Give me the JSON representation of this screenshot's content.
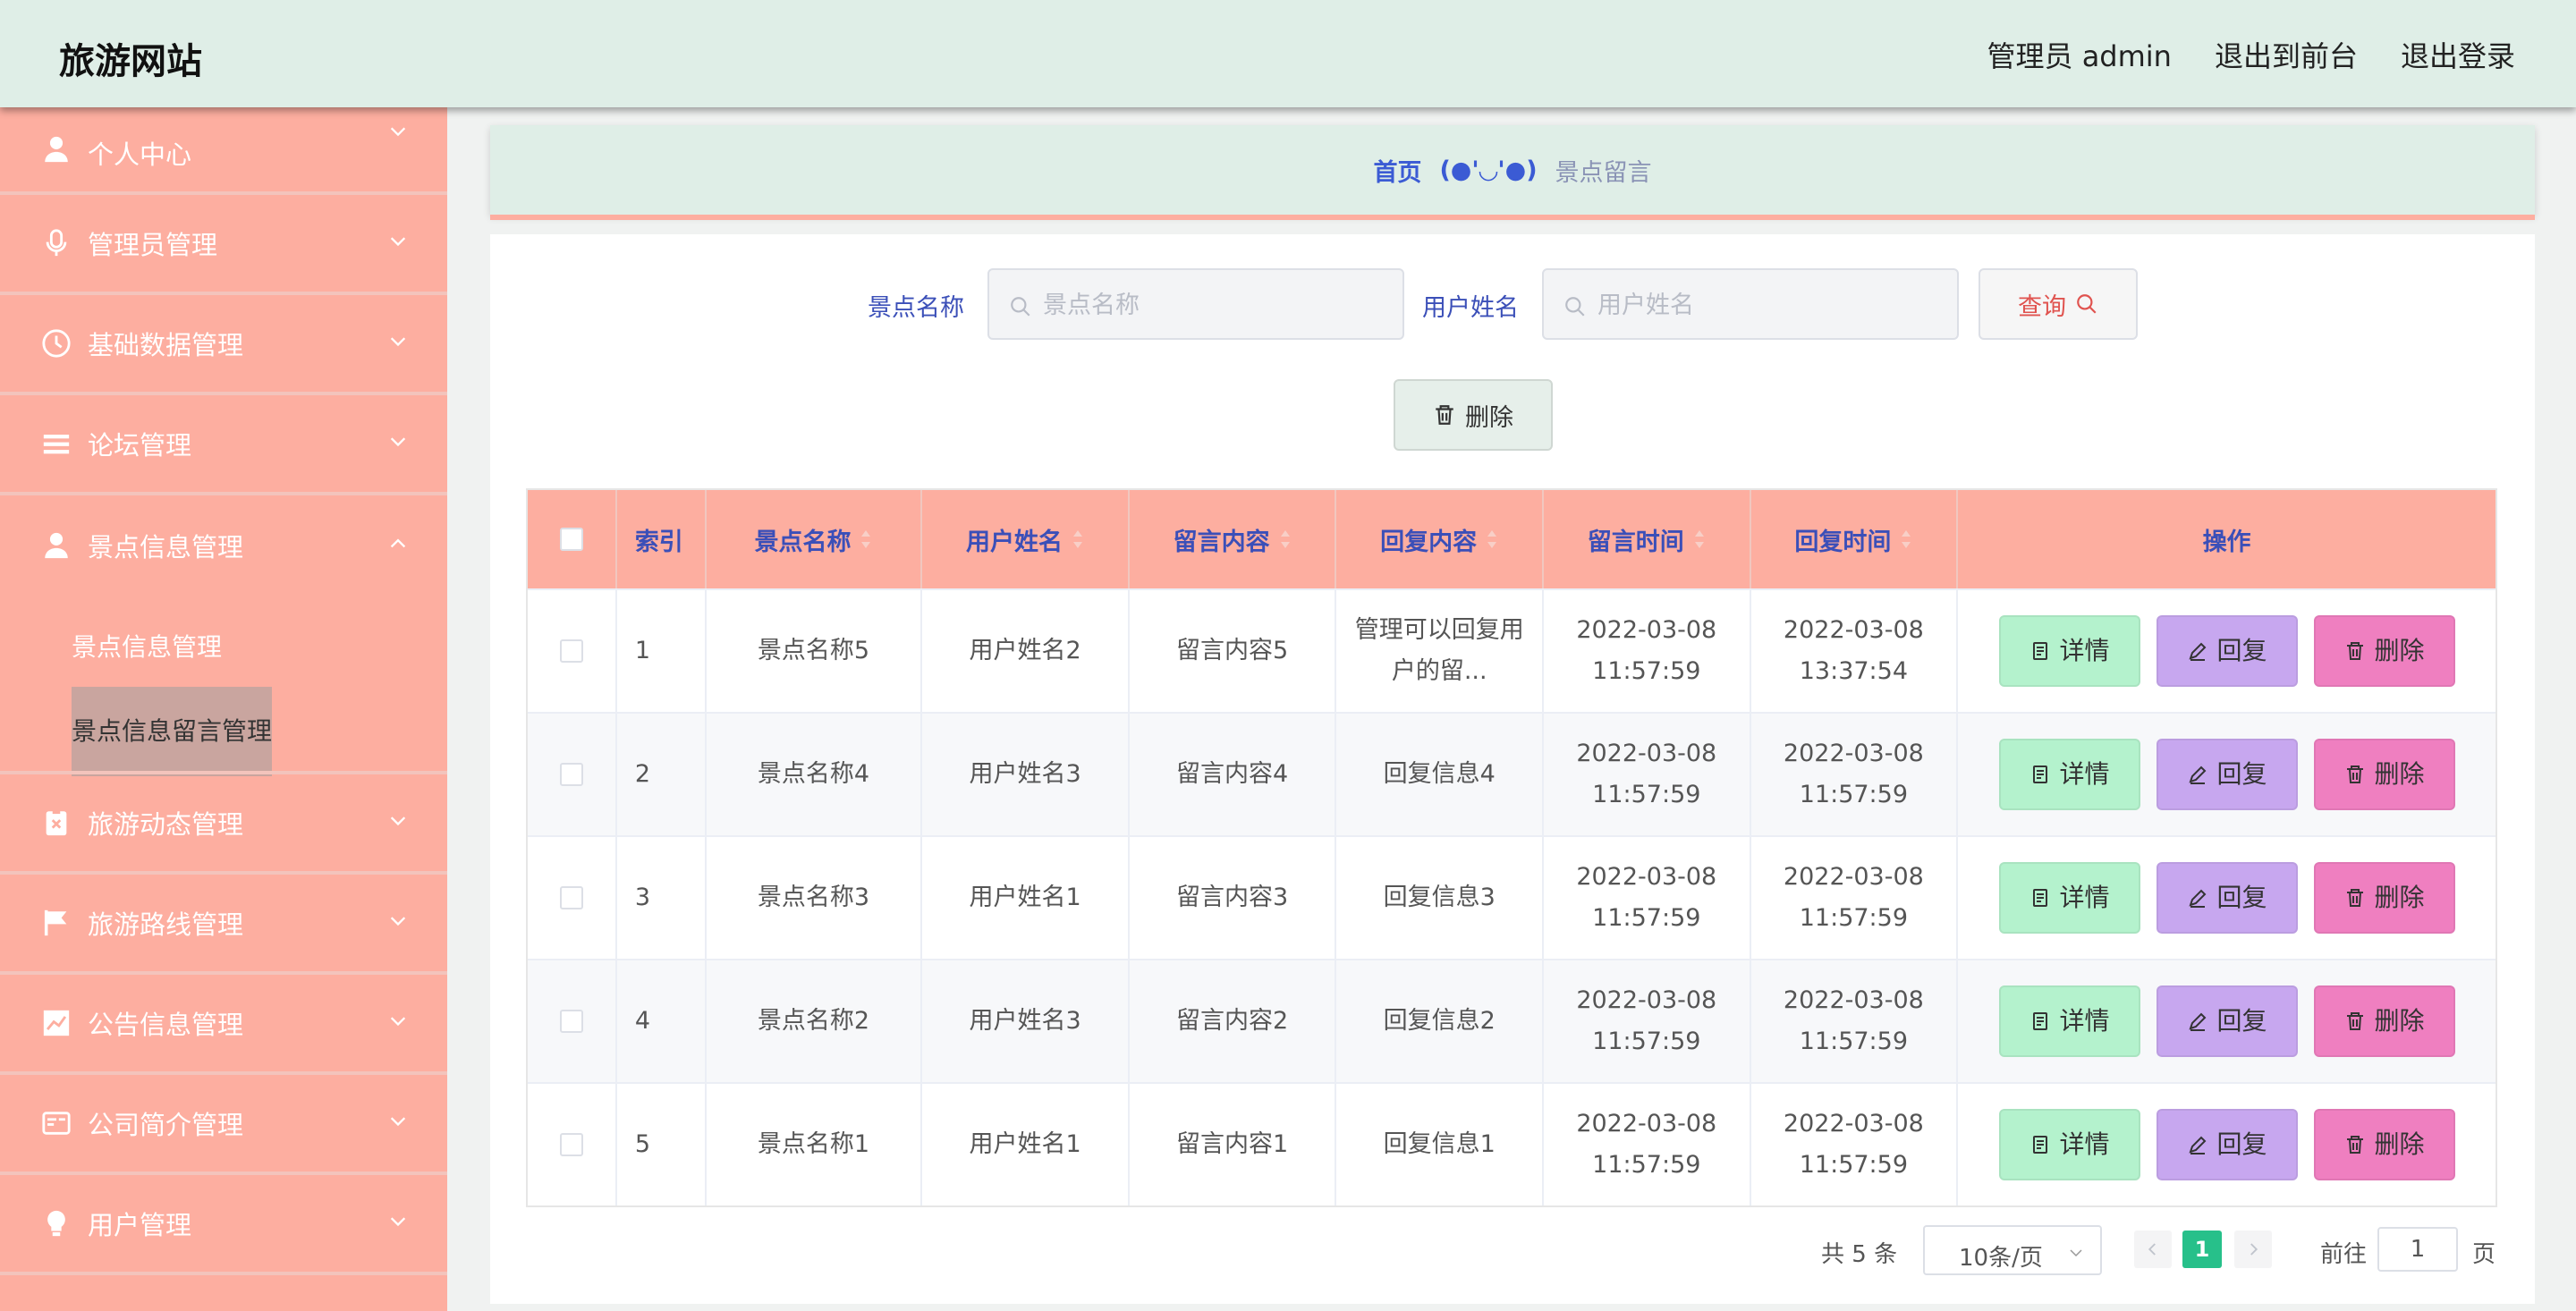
{
  "header": {
    "brand": "旅游网站",
    "admin_label": "管理员 admin",
    "to_front": "退出到前台",
    "logout": "退出登录"
  },
  "sidebar": {
    "items": [
      {
        "label": "个人中心",
        "icon": "user-icon"
      },
      {
        "label": "管理员管理",
        "icon": "microphone-icon"
      },
      {
        "label": "基础数据管理",
        "icon": "clock-icon"
      },
      {
        "label": "论坛管理",
        "icon": "list-icon"
      },
      {
        "label": "景点信息管理",
        "icon": "user-icon",
        "expanded": true
      },
      {
        "label": "旅游动态管理",
        "icon": "clipboard-icon"
      },
      {
        "label": "旅游路线管理",
        "icon": "flag-icon"
      },
      {
        "label": "公告信息管理",
        "icon": "chart-icon"
      },
      {
        "label": "公司简介管理",
        "icon": "card-icon"
      },
      {
        "label": "用户管理",
        "icon": "bulb-icon"
      }
    ],
    "submenu": [
      "景点信息管理",
      "景点信息留言管理"
    ]
  },
  "breadcrumb": {
    "home": "首页",
    "separator": "(●'◡'●)",
    "current": "景点留言"
  },
  "search": {
    "spot_label": "景点名称",
    "spot_placeholder": "景点名称",
    "user_label": "用户姓名",
    "user_placeholder": "用户姓名",
    "query_label": "查询"
  },
  "toolbar": {
    "delete_label": "删除"
  },
  "table": {
    "headers": [
      "索引",
      "景点名称",
      "用户姓名",
      "留言内容",
      "回复内容",
      "留言时间",
      "回复时间",
      "操作"
    ],
    "rows": [
      {
        "idx": "1",
        "spot": "景点名称5",
        "user": "用户姓名2",
        "msg": "留言内容5",
        "reply": "管理可以回复用户的留...",
        "msg_time": "2022-03-08 11:57:59",
        "reply_time": "2022-03-08 13:37:54"
      },
      {
        "idx": "2",
        "spot": "景点名称4",
        "user": "用户姓名3",
        "msg": "留言内容4",
        "reply": "回复信息4",
        "msg_time": "2022-03-08 11:57:59",
        "reply_time": "2022-03-08 11:57:59"
      },
      {
        "idx": "3",
        "spot": "景点名称3",
        "user": "用户姓名1",
        "msg": "留言内容3",
        "reply": "回复信息3",
        "msg_time": "2022-03-08 11:57:59",
        "reply_time": "2022-03-08 11:57:59"
      },
      {
        "idx": "4",
        "spot": "景点名称2",
        "user": "用户姓名3",
        "msg": "留言内容2",
        "reply": "回复信息2",
        "msg_time": "2022-03-08 11:57:59",
        "reply_time": "2022-03-08 11:57:59"
      },
      {
        "idx": "5",
        "spot": "景点名称1",
        "user": "用户姓名1",
        "msg": "留言内容1",
        "reply": "回复信息1",
        "msg_time": "2022-03-08 11:57:59",
        "reply_time": "2022-03-08 11:57:59"
      }
    ],
    "actions": {
      "detail": "详情",
      "reply": "回复",
      "delete": "删除"
    }
  },
  "pagination": {
    "total": "共 5 条",
    "page_size": "10条/页",
    "current_page": "1",
    "goto_label": "前往",
    "goto_value": "1",
    "page_suffix": "页"
  },
  "colors": {
    "header_bg": "#dfeee7",
    "sidebar_bg": "#fdaea0",
    "accent_blue": "#3b4fb8",
    "detail_btn": "#b4f2cd",
    "reply_btn": "#c7a7ef",
    "delete_btn": "#ef7fc0",
    "pager_active": "#27c08a"
  }
}
